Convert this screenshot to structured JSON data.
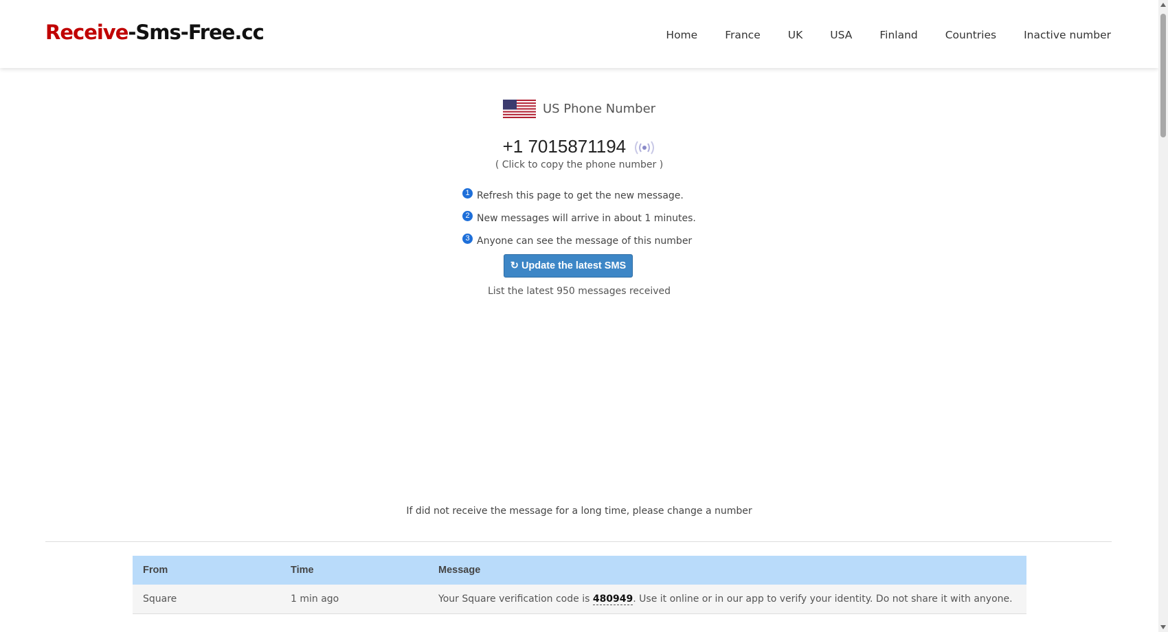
{
  "header": {
    "brand_part1": "Receive",
    "brand_part2": "-Sms-Free.cc",
    "nav": [
      "Home",
      "France",
      "UK",
      "USA",
      "Finland",
      "Countries",
      "Inactive number"
    ]
  },
  "number": {
    "country_label": "US Phone Number",
    "phone": "+1 7015871194",
    "copy_hint": "( Click to copy the phone number )",
    "flag_icon": "us-flag-icon",
    "signal_icon": "broadcast-icon"
  },
  "tips": [
    {
      "num": "1",
      "text": "Refresh this page to get the new message."
    },
    {
      "num": "2",
      "text": "New messages will arrive in about 1 minutes."
    },
    {
      "num": "3",
      "text": "Anyone can see the message of this number"
    }
  ],
  "update_button": {
    "icon": "↻",
    "label": "Update the latest SMS"
  },
  "list_count": "List the latest 950 messages received",
  "change_hint": "If did not receive the message for a long time, please change a number",
  "table": {
    "headers": [
      "From",
      "Time",
      "Message"
    ],
    "rows": [
      {
        "from": "Square",
        "time": "1 min ago",
        "message_pre": "Your Square verification code is ",
        "code": "480949",
        "message_post": ". Use it online or in our app to verify your identity. Do not share it with anyone."
      }
    ]
  },
  "colors": {
    "brand_red": "#c00000",
    "button_blue": "#3d86c6",
    "table_header_blue": "#b9dbfa",
    "tip_badge_blue": "#1e6fd9"
  }
}
